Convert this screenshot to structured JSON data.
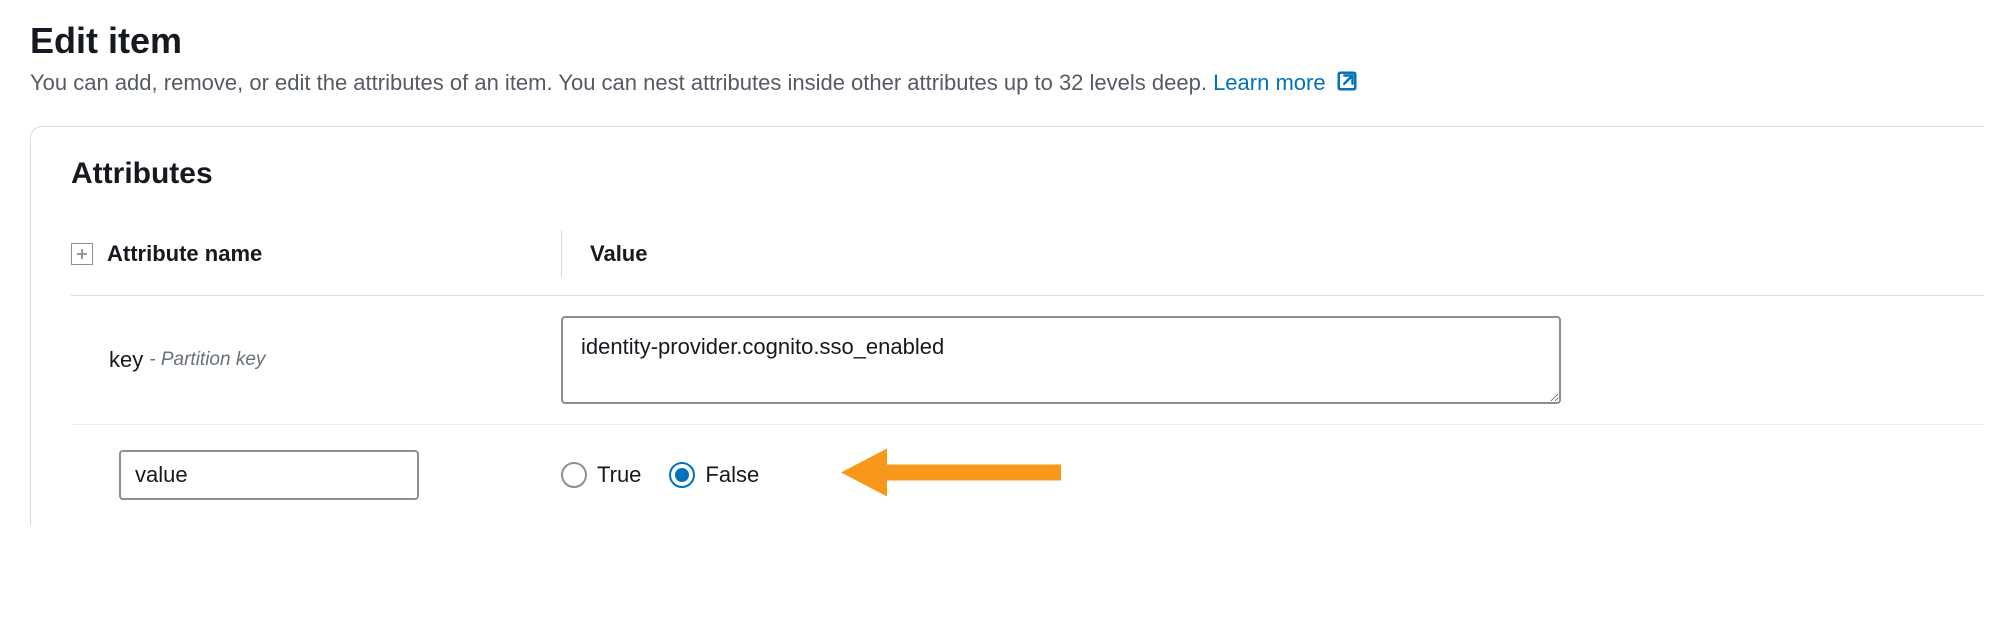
{
  "page": {
    "title": "Edit item",
    "description": "You can add, remove, or edit the attributes of an item. You can nest attributes inside other attributes up to 32 levels deep.",
    "learn_more_label": "Learn more"
  },
  "panel": {
    "title": "Attributes",
    "columns": {
      "attribute_name": "Attribute name",
      "value": "Value"
    },
    "rows": [
      {
        "attr_name": "key",
        "attr_hint": "- Partition key",
        "value_type": "text",
        "value": "identity-provider.cognito.sso_enabled"
      },
      {
        "attr_name": "value",
        "value_type": "boolean",
        "options": {
          "true_label": "True",
          "false_label": "False"
        },
        "selected": "false"
      }
    ]
  }
}
